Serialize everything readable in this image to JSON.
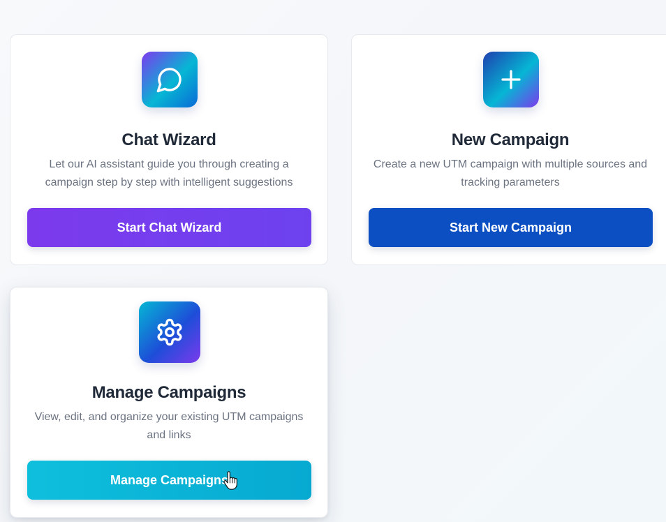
{
  "cards": [
    {
      "id": "chat-wizard",
      "icon": "chat-bubble-icon",
      "title": "Chat Wizard",
      "description": "Let our AI assistant guide you through creating a campaign step by step with intelligent suggestions",
      "button_label": "Start Chat Wizard",
      "accent": "#7c3aed"
    },
    {
      "id": "new-campaign",
      "icon": "plus-icon",
      "title": "New Campaign",
      "description": "Create a new UTM campaign with multiple sources and tracking parameters",
      "button_label": "Start New Campaign",
      "accent": "#0b4fc2"
    },
    {
      "id": "manage-campaigns",
      "icon": "gear-icon",
      "title": "Manage Campaigns",
      "description": "View, edit, and organize your existing UTM campaigns and links",
      "button_label": "Manage Campaigns",
      "accent": "#07a9d1"
    }
  ],
  "cursor": "hand-pointer-icon"
}
